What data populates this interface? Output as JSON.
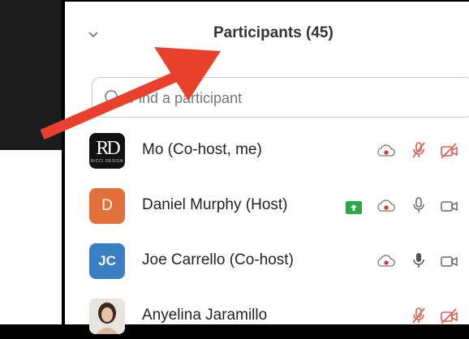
{
  "panel": {
    "title": "Participants (45)",
    "search_placeholder": "Find a participant"
  },
  "participants": [
    {
      "name": "Mo (Co-host, me)",
      "avatar_text": "RD",
      "avatar_subtext": "RICCI DESIGN",
      "avatar_color": "#111111"
    },
    {
      "name": "Daniel Murphy (Host)",
      "avatar_text": "D",
      "avatar_color": "#e2703a"
    },
    {
      "name": "Joe Carrello (Co-host)",
      "avatar_text": "JC",
      "avatar_color": "#3a7fc4"
    },
    {
      "name": "Anyelina Jaramillo",
      "avatar_text": "",
      "avatar_color": "#e8e4df"
    }
  ],
  "icons": {
    "record": "record-icon",
    "mic_muted": "mic-muted-icon",
    "video_off": "video-off-icon",
    "mic": "mic-icon",
    "video": "video-icon",
    "share": "share-screen-icon",
    "chevron": "chevron-down-icon"
  },
  "colors": {
    "annotation_arrow": "#e8402a",
    "muted_red": "#e05a4e",
    "share_green": "#2aa84a",
    "record_red": "#e0322c"
  }
}
